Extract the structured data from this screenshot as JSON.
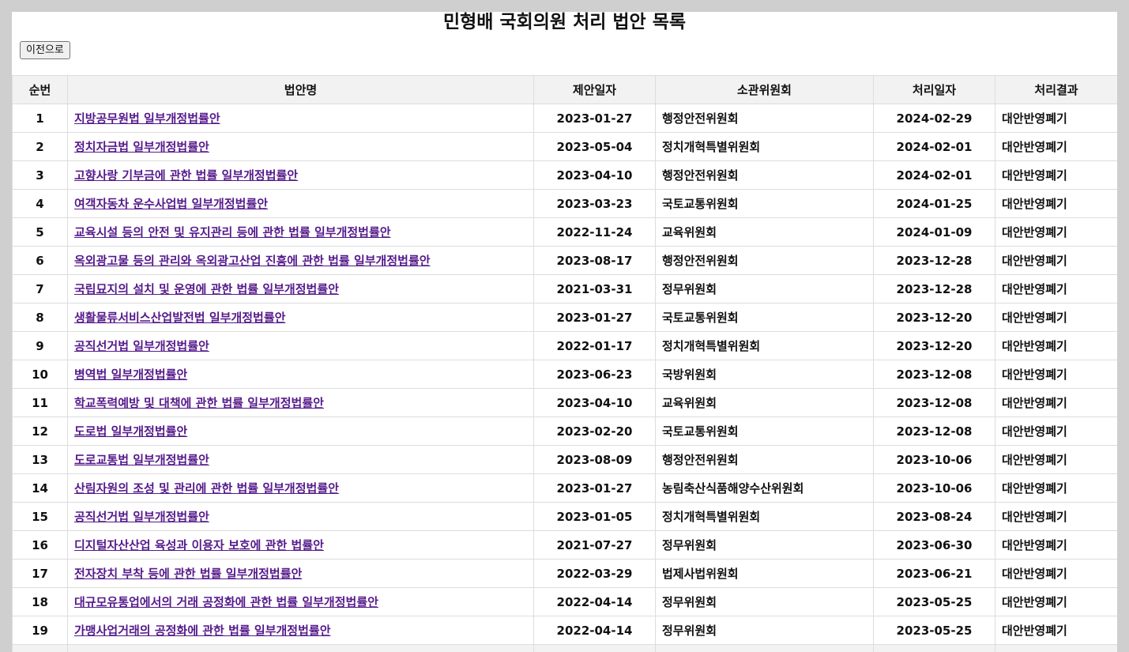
{
  "title": "민형배 국회의원 처리 법안 목록",
  "back_label": "이전으로",
  "headers": [
    "순번",
    "법안명",
    "제안일자",
    "소관위원회",
    "처리일자",
    "처리결과"
  ],
  "rows": [
    {
      "seq": "1",
      "name": "지방공무원법 일부개정법률안",
      "proposed": "2023-01-27",
      "committee": "행정안전위원회",
      "processed": "2024-02-29",
      "result": "대안반영폐기"
    },
    {
      "seq": "2",
      "name": "정치자금법 일부개정법률안",
      "proposed": "2023-05-04",
      "committee": "정치개혁특별위원회",
      "processed": "2024-02-01",
      "result": "대안반영폐기"
    },
    {
      "seq": "3",
      "name": "고향사랑 기부금에 관한 법률 일부개정법률안",
      "proposed": "2023-04-10",
      "committee": "행정안전위원회",
      "processed": "2024-02-01",
      "result": "대안반영폐기"
    },
    {
      "seq": "4",
      "name": "여객자동차 운수사업법 일부개정법률안",
      "proposed": "2023-03-23",
      "committee": "국토교통위원회",
      "processed": "2024-01-25",
      "result": "대안반영폐기"
    },
    {
      "seq": "5",
      "name": "교육시설 등의 안전 및 유지관리 등에 관한 법률 일부개정법률안",
      "proposed": "2022-11-24",
      "committee": "교육위원회",
      "processed": "2024-01-09",
      "result": "대안반영폐기"
    },
    {
      "seq": "6",
      "name": "옥외광고물 등의 관리와 옥외광고산업 진흥에 관한 법률 일부개정법률안",
      "proposed": "2023-08-17",
      "committee": "행정안전위원회",
      "processed": "2023-12-28",
      "result": "대안반영폐기"
    },
    {
      "seq": "7",
      "name": "국립묘지의 설치 및 운영에 관한 법률 일부개정법률안",
      "proposed": "2021-03-31",
      "committee": "정무위원회",
      "processed": "2023-12-28",
      "result": "대안반영폐기"
    },
    {
      "seq": "8",
      "name": "생활물류서비스산업발전법 일부개정법률안",
      "proposed": "2023-01-27",
      "committee": "국토교통위원회",
      "processed": "2023-12-20",
      "result": "대안반영폐기"
    },
    {
      "seq": "9",
      "name": "공직선거법 일부개정법률안",
      "proposed": "2022-01-17",
      "committee": "정치개혁특별위원회",
      "processed": "2023-12-20",
      "result": "대안반영폐기"
    },
    {
      "seq": "10",
      "name": "병역법 일부개정법률안",
      "proposed": "2023-06-23",
      "committee": "국방위원회",
      "processed": "2023-12-08",
      "result": "대안반영폐기"
    },
    {
      "seq": "11",
      "name": "학교폭력예방 및 대책에 관한 법률 일부개정법률안",
      "proposed": "2023-04-10",
      "committee": "교육위원회",
      "processed": "2023-12-08",
      "result": "대안반영폐기"
    },
    {
      "seq": "12",
      "name": "도로법 일부개정법률안",
      "proposed": "2023-02-20",
      "committee": "국토교통위원회",
      "processed": "2023-12-08",
      "result": "대안반영폐기"
    },
    {
      "seq": "13",
      "name": "도로교통법 일부개정법률안",
      "proposed": "2023-08-09",
      "committee": "행정안전위원회",
      "processed": "2023-10-06",
      "result": "대안반영폐기"
    },
    {
      "seq": "14",
      "name": "산림자원의 조성 및 관리에 관한 법률 일부개정법률안",
      "proposed": "2023-01-27",
      "committee": "농림축산식품해양수산위원회",
      "processed": "2023-10-06",
      "result": "대안반영폐기"
    },
    {
      "seq": "15",
      "name": "공직선거법 일부개정법률안",
      "proposed": "2023-01-05",
      "committee": "정치개혁특별위원회",
      "processed": "2023-08-24",
      "result": "대안반영폐기"
    },
    {
      "seq": "16",
      "name": "디지털자산산업 육성과 이용자 보호에 관한 법률안",
      "proposed": "2021-07-27",
      "committee": "정무위원회",
      "processed": "2023-06-30",
      "result": "대안반영폐기"
    },
    {
      "seq": "17",
      "name": "전자장치 부착 등에 관한 법률 일부개정법률안",
      "proposed": "2022-03-29",
      "committee": "법제사법위원회",
      "processed": "2023-06-21",
      "result": "대안반영폐기"
    },
    {
      "seq": "18",
      "name": "대규모유통업에서의 거래 공정화에 관한 법률 일부개정법률안",
      "proposed": "2022-04-14",
      "committee": "정무위원회",
      "processed": "2023-05-25",
      "result": "대안반영폐기"
    },
    {
      "seq": "19",
      "name": "가맹사업거래의 공정화에 관한 법률 일부개정법률안",
      "proposed": "2022-04-14",
      "committee": "정무위원회",
      "processed": "2023-05-25",
      "result": "대안반영폐기"
    }
  ]
}
